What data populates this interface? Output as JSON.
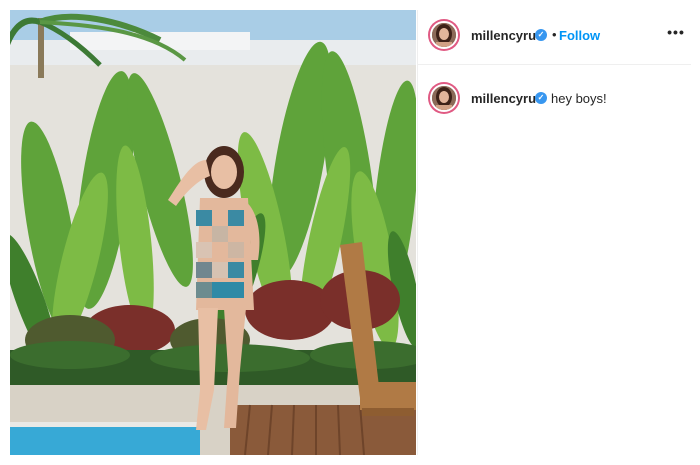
{
  "post": {
    "author": {
      "username": "millencyrus",
      "verified": true,
      "avatar_icon": "profile-photo",
      "verified_icon": "verified-badge-icon"
    },
    "header": {
      "separator": "•",
      "follow_label": "Follow",
      "more_label": "•••"
    },
    "caption": {
      "username": "millencyrus",
      "text": "hey boys!"
    },
    "media": {
      "description_icon": "post-photo"
    }
  },
  "colors": {
    "follow_blue": "#0095f6",
    "verified_blue": "#3897f0",
    "text": "#262626",
    "divider": "#efefef"
  }
}
